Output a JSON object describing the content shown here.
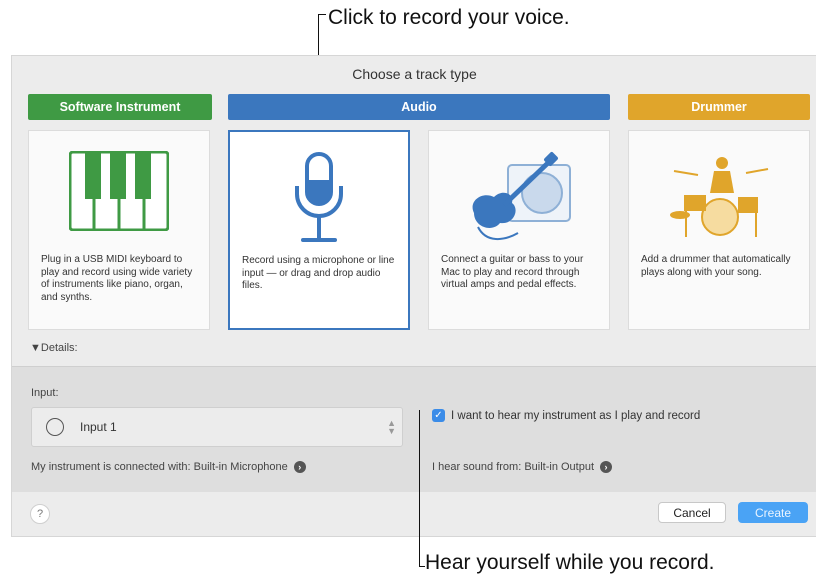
{
  "callouts": {
    "top": "Click to record your voice.",
    "bottom": "Hear yourself while you record."
  },
  "dialog": {
    "title": "Choose a track type",
    "categories": {
      "software_instrument": "Software Instrument",
      "audio": "Audio",
      "drummer": "Drummer"
    },
    "cards": [
      {
        "id": "software-instrument",
        "icon": "piano-keyboard-icon",
        "description": "Plug in a USB MIDI keyboard to play and record using wide variety of instruments like piano, organ, and synths."
      },
      {
        "id": "microphone",
        "icon": "microphone-icon",
        "selected": true,
        "description": "Record using a microphone or line input — or drag and drop audio files."
      },
      {
        "id": "guitar",
        "icon": "guitar-icon",
        "description": "Connect a guitar or bass to your Mac to play and record through virtual amps and pedal effects."
      },
      {
        "id": "drummer",
        "icon": "drum-kit-icon",
        "description": "Add a drummer that automatically plays along with your song."
      }
    ],
    "details_toggle": "▼Details:",
    "details": {
      "input_label": "Input:",
      "input_value": "Input 1",
      "connected_with": "My instrument is connected with: Built-in Microphone",
      "monitor_checkbox_label": "I want to hear my instrument as I play and record",
      "monitor_checked": true,
      "hear_sound_from": "I hear sound from: Built-in Output"
    },
    "footer": {
      "help": "?",
      "cancel": "Cancel",
      "create": "Create"
    }
  },
  "colors": {
    "software_instrument": "#3f9a44",
    "audio": "#3b77be",
    "drummer": "#e0a52b",
    "create_button": "#4aa3f5"
  }
}
